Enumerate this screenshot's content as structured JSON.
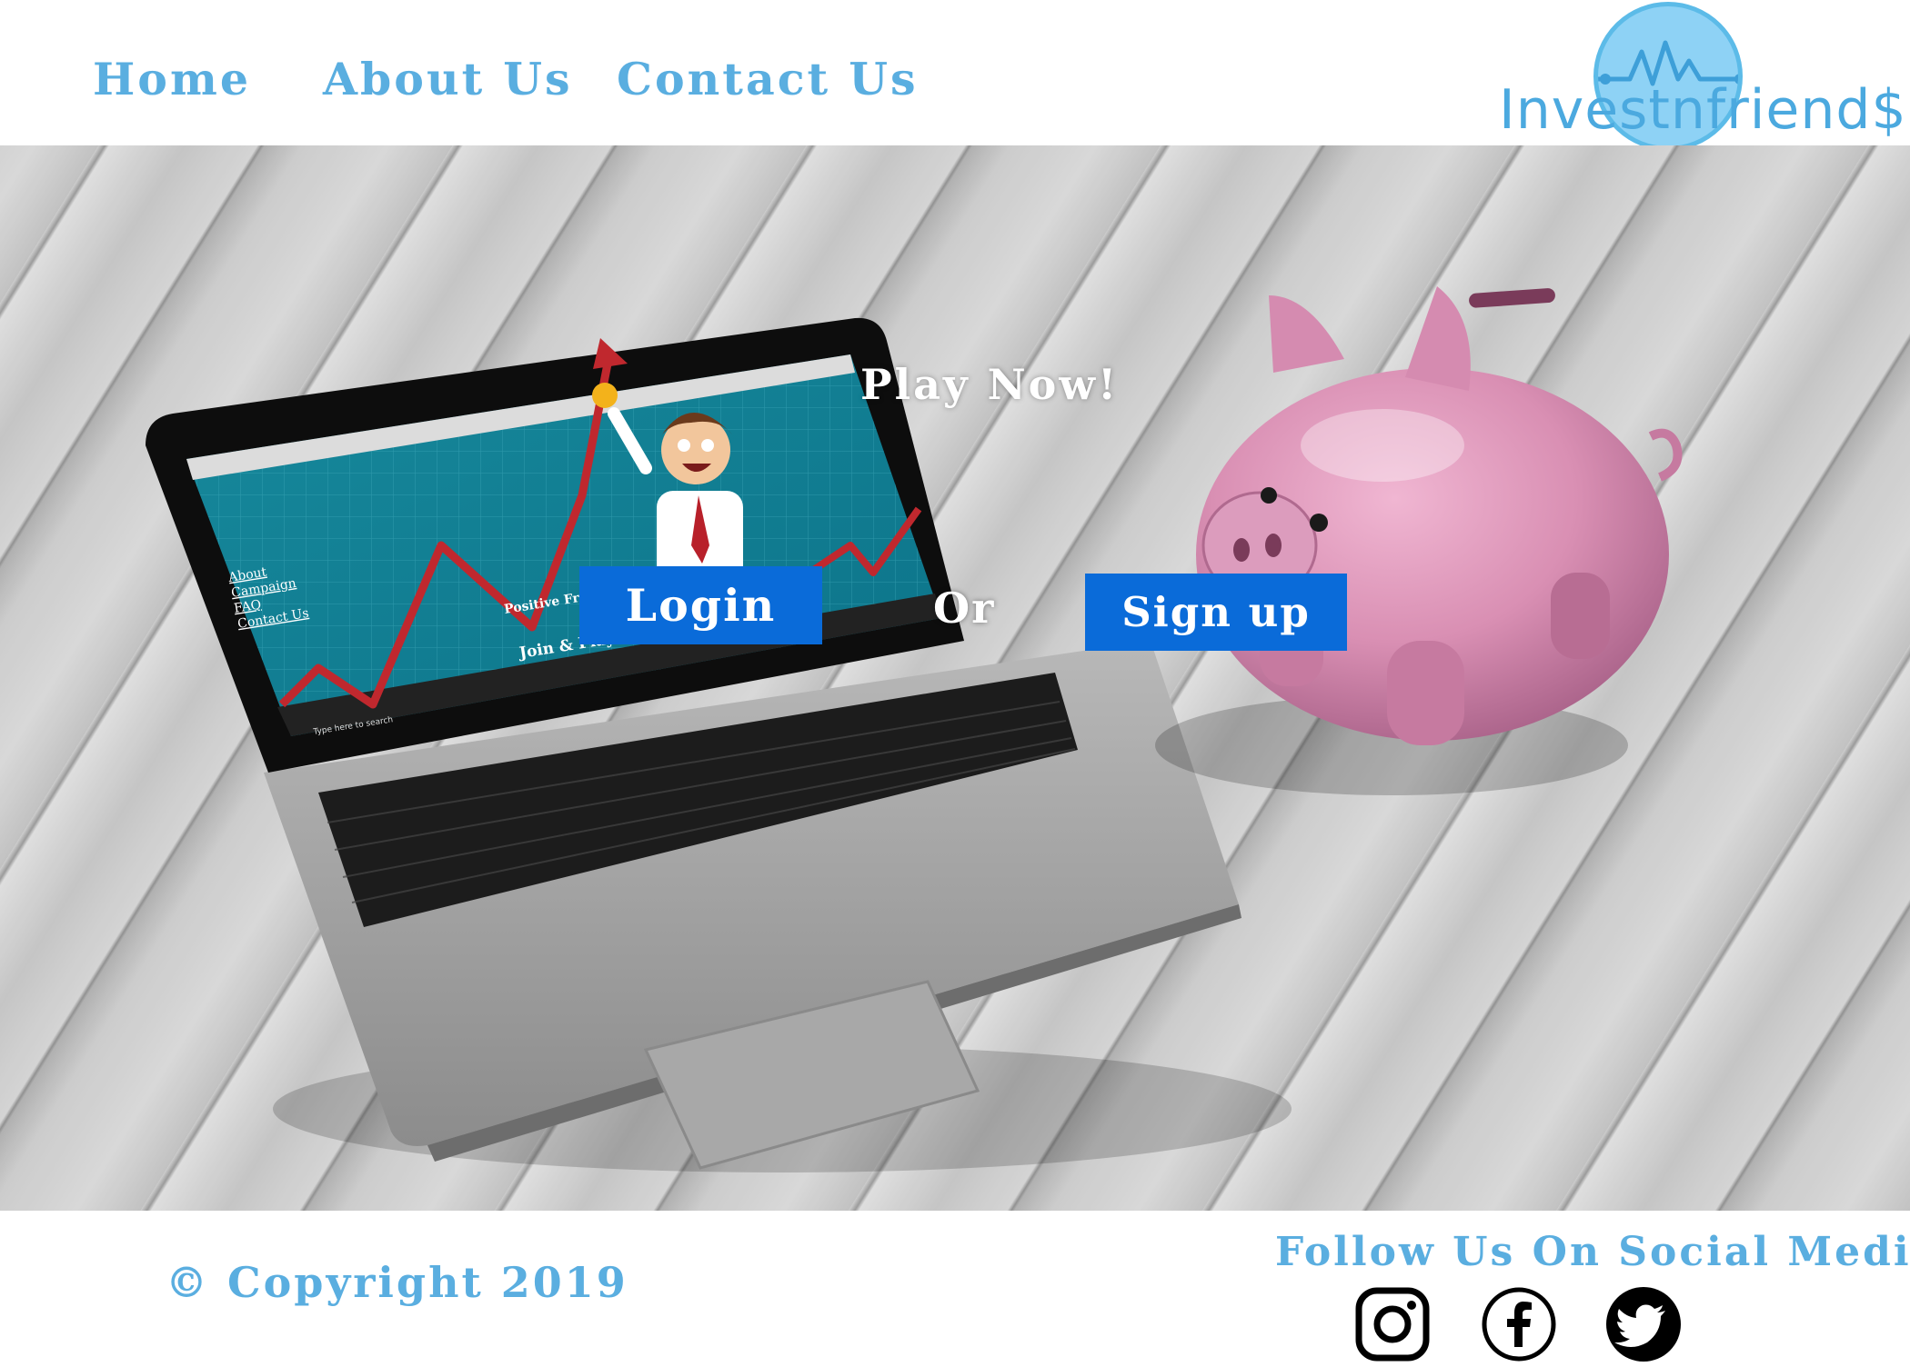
{
  "nav": {
    "home": "Home",
    "about": "About Us",
    "contact": "Contact Us"
  },
  "logo": {
    "text": "Investnfriend$"
  },
  "hero": {
    "image_description_icons": [
      "laptop-illustration",
      "piggy-bank-illustration",
      "wood-floor-background"
    ],
    "play_now": "Play Now!",
    "login_label": "Login",
    "or_label": "Or",
    "signup_label": "Sign up"
  },
  "laptop_screen": {
    "side_links": [
      "About",
      "Campaign",
      "FAQ",
      "Contact Us"
    ],
    "headline": "Positive FriendS Matter",
    "subhead": "Join & Play Now!",
    "taskbar_search": "Type here to search"
  },
  "footer": {
    "copyright": "© Copyright 2019",
    "follow": "Follow Us On Social Media",
    "social_icons": [
      "instagram-icon",
      "facebook-icon",
      "twitter-icon"
    ]
  },
  "colors": {
    "nav_text": "#5aaee0",
    "button_bg": "#0a6bd9",
    "logo_circle": "#8ed2f5",
    "piggy_pink": "#d98fb3"
  }
}
